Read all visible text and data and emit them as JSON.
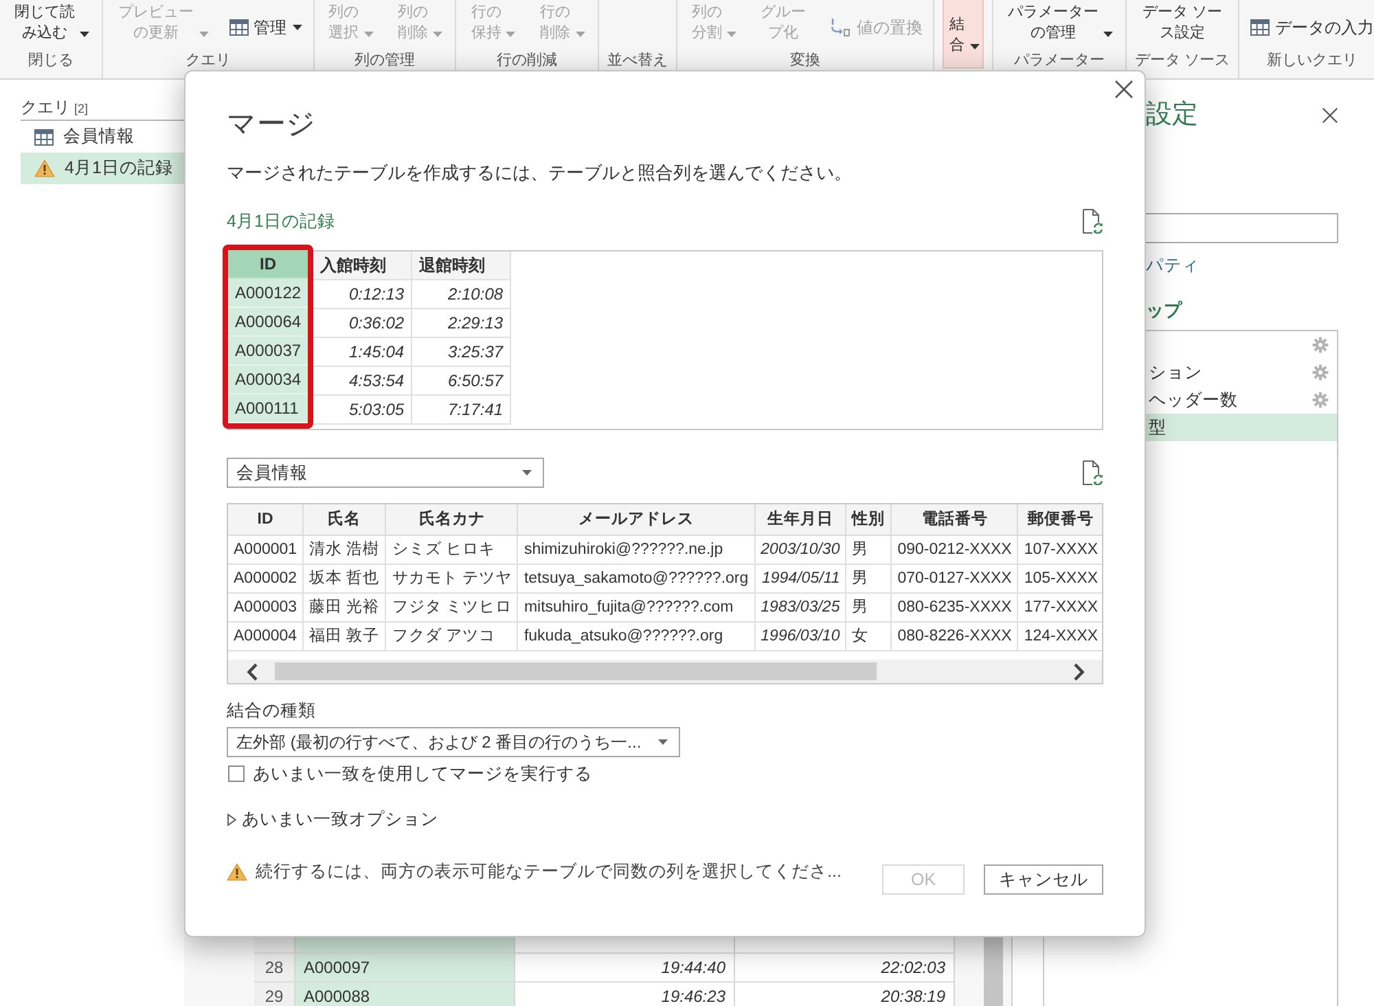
{
  "ribbon": {
    "groups": [
      {
        "label": "閉じる",
        "buttons": [
          {
            "label": "閉じて読み込む",
            "kind": "large",
            "dropdown": true,
            "disabled": false,
            "pressed": false
          }
        ]
      },
      {
        "label": "クエリ",
        "buttons": [
          {
            "label": "プレビューの更新",
            "kind": "large",
            "dropdown": true,
            "disabled": true,
            "pressed": false
          },
          {
            "label": "管理",
            "kind": "table",
            "dropdown": true,
            "disabled": false,
            "pressed": false
          }
        ]
      },
      {
        "label": "列の管理",
        "buttons": [
          {
            "label": "列の選択",
            "kind": "large",
            "dropdown": true,
            "disabled": true,
            "pressed": false
          },
          {
            "label": "列の削除",
            "kind": "large",
            "dropdown": true,
            "disabled": true,
            "pressed": false
          }
        ]
      },
      {
        "label": "行の削減",
        "buttons": [
          {
            "label": "行の保持",
            "kind": "large",
            "dropdown": true,
            "disabled": true,
            "pressed": false
          },
          {
            "label": "行の削除",
            "kind": "large",
            "dropdown": true,
            "disabled": true,
            "pressed": false
          }
        ]
      },
      {
        "label": "並べ替え"
      },
      {
        "label": "変換",
        "buttons": [
          {
            "label": "列の分割",
            "kind": "large",
            "dropdown": true,
            "disabled": true,
            "pressed": false
          },
          {
            "label": "グループ化",
            "kind": "large",
            "dropdown": false,
            "disabled": true,
            "pressed": false
          },
          {
            "label": "値の置換",
            "kind": "replace",
            "dropdown": false,
            "disabled": true,
            "pressed": false
          }
        ]
      },
      {
        "buttons": [
          {
            "label": "結合",
            "kind": "large",
            "dropdown": true,
            "disabled": false,
            "pressed": true
          }
        ]
      },
      {
        "label": "パラメーター",
        "buttons": [
          {
            "label": "パラメーターの管理",
            "kind": "large",
            "dropdown": true,
            "disabled": false,
            "pressed": false
          }
        ]
      },
      {
        "label": "データ ソース",
        "buttons": [
          {
            "label": "データ ソース設定",
            "kind": "large",
            "dropdown": false,
            "disabled": false,
            "pressed": false
          }
        ]
      },
      {
        "label": "新しいクエリ",
        "buttons": [
          {
            "label": "データの入力",
            "kind": "table",
            "dropdown": false,
            "disabled": false,
            "pressed": false
          }
        ]
      }
    ]
  },
  "queries_pane": {
    "title": "クエリ",
    "count": "[2]",
    "items": [
      {
        "name": "会員情報",
        "kind": "table",
        "selected": false
      },
      {
        "name": "4月1日の記録",
        "kind": "warning",
        "selected": true
      }
    ]
  },
  "data_grid": {
    "columns": [
      {
        "kind": "text",
        "selected": true
      },
      {
        "kind": "time",
        "selected": false
      },
      {
        "kind": "time",
        "selected": false
      }
    ],
    "rows": [
      {
        "number": "28",
        "cells": [
          "A000097",
          "19:44:40",
          "22:02:03"
        ]
      },
      {
        "number": "29",
        "cells": [
          "A000088",
          "19:46:23",
          "20:38:19"
        ]
      }
    ]
  },
  "settings_pane": {
    "title": "設定",
    "properties_link": "パティ",
    "steps_heading": "ップ",
    "steps": [
      {
        "settings_icon": true,
        "selected": false
      },
      {
        "label": "ション",
        "settings_icon": true,
        "selected": false
      },
      {
        "label": "ヘッダー数",
        "settings_icon": true,
        "selected": false
      },
      {
        "label": "型",
        "settings_icon": false,
        "selected": true
      }
    ]
  },
  "dialog": {
    "title": "マージ",
    "description": "マージされたテーブルを作成するには、テーブルと照合列を選んでください。",
    "first_table": {
      "name": "4月1日の記録",
      "columns": [
        {
          "header": "ID",
          "kind": "text",
          "selected": true,
          "highlighted": true
        },
        {
          "header": "入館時刻",
          "kind": "time",
          "selected": false,
          "highlighted": false
        },
        {
          "header": "退館時刻",
          "kind": "time",
          "selected": false,
          "highlighted": false
        }
      ],
      "rows": [
        [
          "A000122",
          "0:12:13",
          "2:10:08"
        ],
        [
          "A000064",
          "0:36:02",
          "2:29:13"
        ],
        [
          "A000037",
          "1:45:04",
          "3:25:37"
        ],
        [
          "A000034",
          "4:53:54",
          "6:50:57"
        ],
        [
          "A000111",
          "5:03:05",
          "7:17:41"
        ]
      ]
    },
    "second_table": {
      "source": "会員情報",
      "columns": [
        {
          "header": "ID",
          "kind": "text",
          "selected": false
        },
        {
          "header": "氏名",
          "kind": "text",
          "selected": false
        },
        {
          "header": "氏名カナ",
          "kind": "text",
          "selected": false
        },
        {
          "header": "メールアドレス",
          "kind": "text",
          "selected": false
        },
        {
          "header": "生年月日",
          "kind": "date",
          "selected": false
        },
        {
          "header": "性別",
          "kind": "text",
          "selected": false
        },
        {
          "header": "電話番号",
          "kind": "text",
          "selected": false
        },
        {
          "header": "郵便番号",
          "kind": "text",
          "selected": false
        }
      ],
      "rows": [
        [
          "A000001",
          "清水 浩樹",
          "シミズ ヒロキ",
          "shimizuhiroki@??????.ne.jp",
          "2003/10/30",
          "男",
          "090-0212-XXXX",
          "107-XXXX"
        ],
        [
          "A000002",
          "坂本 哲也",
          "サカモト テツヤ",
          "tetsuya_sakamoto@??????.org",
          "1994/05/11",
          "男",
          "070-0127-XXXX",
          "105-XXXX"
        ],
        [
          "A000003",
          "藤田 光裕",
          "フジタ ミツヒロ",
          "mitsuhiro_fujita@??????.com",
          "1983/03/25",
          "男",
          "080-6235-XXXX",
          "177-XXXX"
        ],
        [
          "A000004",
          "福田 敦子",
          "フクダ アツコ",
          "fukuda_atsuko@??????.org",
          "1996/03/10",
          "女",
          "080-8226-XXXX",
          "124-XXXX"
        ]
      ]
    },
    "join_kind": {
      "label": "結合の種類",
      "value": "左外部 (最初の行すべて、および 2 番目の行のうち一..."
    },
    "fuzzy_matching": {
      "label": "あいまい一致を使用してマージを実行する",
      "checked": false
    },
    "fuzzy_options": {
      "label": "あいまい一致オプション",
      "expanded": false
    },
    "message": "続行するには、両方の表示可能なテーブルで同数の列を選択してくださ...",
    "buttons": [
      {
        "label": "OK",
        "disabled": true
      },
      {
        "label": "キャンセル",
        "disabled": false
      }
    ]
  }
}
